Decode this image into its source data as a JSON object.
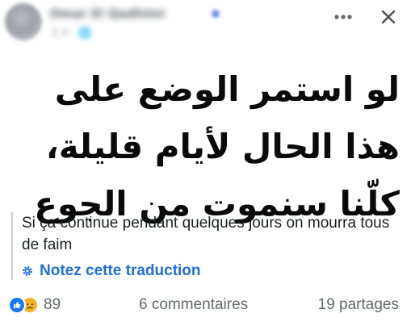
{
  "post": {
    "author_name": "Omar El Qadhimi",
    "meta": "1 h · 🌐",
    "arabic_body": "لو استمر الوضع على هذا الحال لأيام قليلة، كلّنا سنموت من الجوع",
    "translation": "Si ça continue pendant quelques jours on mourra tous de faim",
    "rate_translation_label": "Notez cette traduction"
  },
  "engagement": {
    "reaction_count": "89",
    "comments_label": "6 commentaires",
    "shares_label": "19 partages"
  },
  "colors": {
    "link_blue": "#216fdb",
    "like_blue": "#1877f2",
    "sad_yellow": "#f7b125",
    "secondary_text": "#65676b"
  },
  "icons": [
    "more-options-icon",
    "close-icon",
    "gear-icon",
    "like-reaction-icon",
    "sad-reaction-icon",
    "verified-badge-icon"
  ]
}
